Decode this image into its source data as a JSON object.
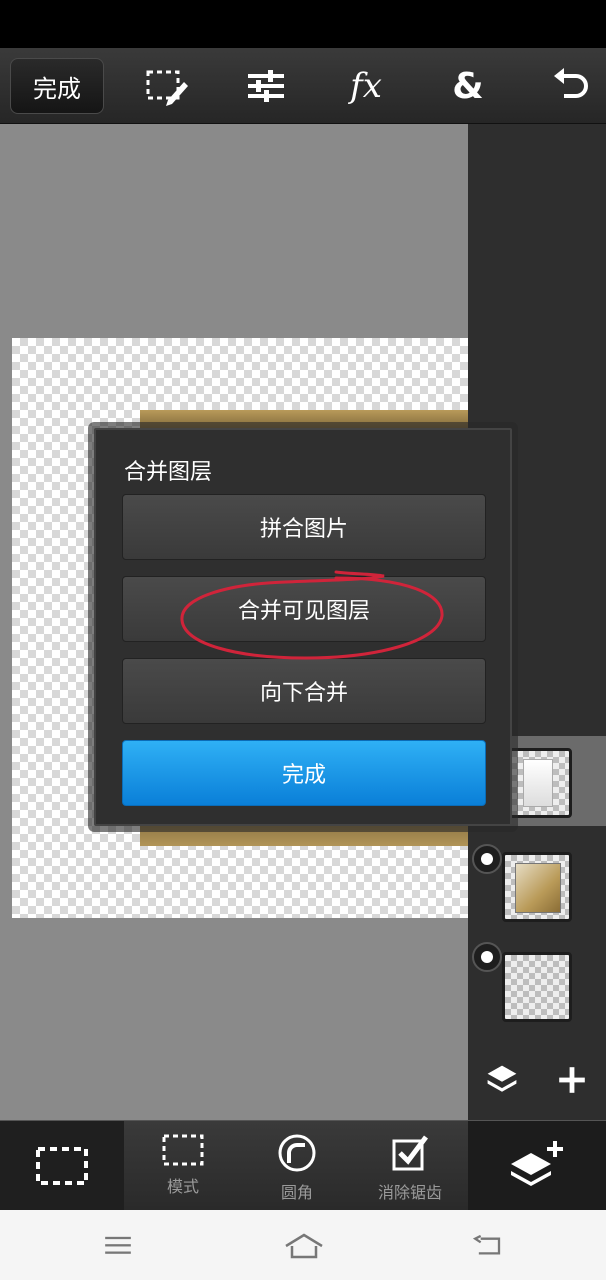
{
  "toolbar": {
    "done_label": "完成",
    "icons": [
      "selection-edit-icon",
      "adjustments-icon",
      "fx-icon",
      "blend-icon",
      "undo-icon"
    ],
    "fx_label": "fx",
    "blend_label": "&"
  },
  "dialog": {
    "title": "合并图层",
    "buttons": {
      "flatten": "拼合图片",
      "merge_visible": "合并可见图层",
      "merge_down": "向下合并",
      "done": "完成"
    }
  },
  "bottom_toolbar": {
    "items": [
      {
        "label": "模式"
      },
      {
        "label": "圆角"
      },
      {
        "label": "消除锯齿"
      }
    ]
  },
  "colors": {
    "primary_button": "#1a95e8",
    "annotation_circle": "#d0243a"
  }
}
